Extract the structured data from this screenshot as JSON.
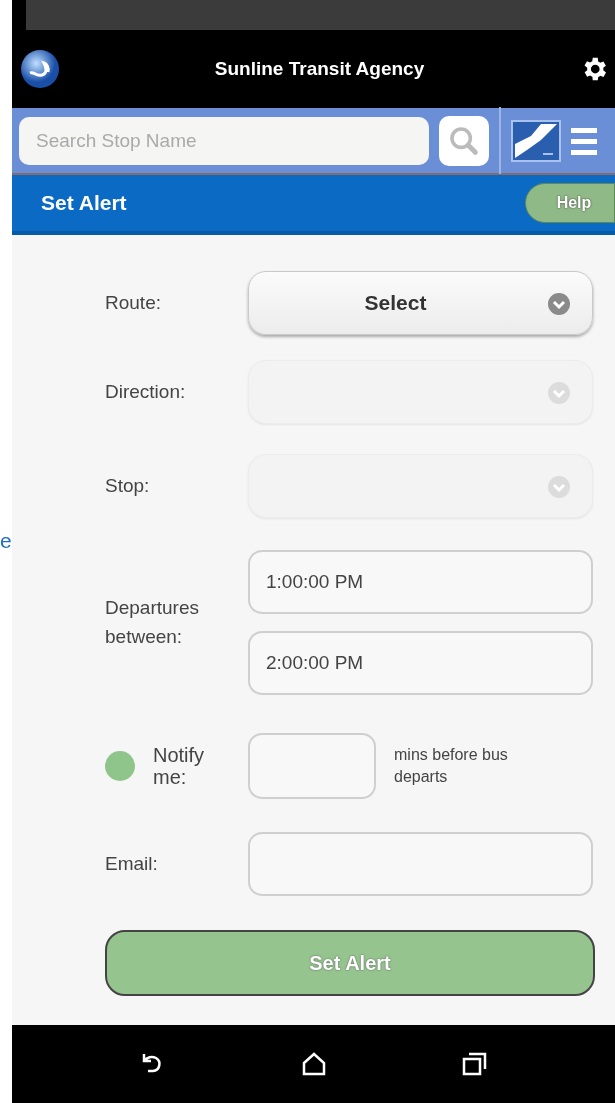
{
  "side_fragment": "e",
  "header": {
    "title": "Sunline Transit Agency"
  },
  "search": {
    "placeholder": "Search Stop Name"
  },
  "page_bar": {
    "title": "Set Alert",
    "help_button": "Help"
  },
  "form": {
    "selects": [
      {
        "label": "Route:",
        "value": "Select",
        "disabled": false
      },
      {
        "label": "Direction:",
        "disabled": true
      },
      {
        "label": "Stop:",
        "disabled": true
      }
    ],
    "departures": {
      "label": "Departures between:",
      "from": "1:00:00 PM",
      "to": "2:00:00 PM"
    },
    "notify": {
      "label": "Notify me:",
      "on": true,
      "suffix": "mins before bus departs"
    },
    "email": {
      "label": "Email:"
    },
    "submit": "Set Alert"
  }
}
